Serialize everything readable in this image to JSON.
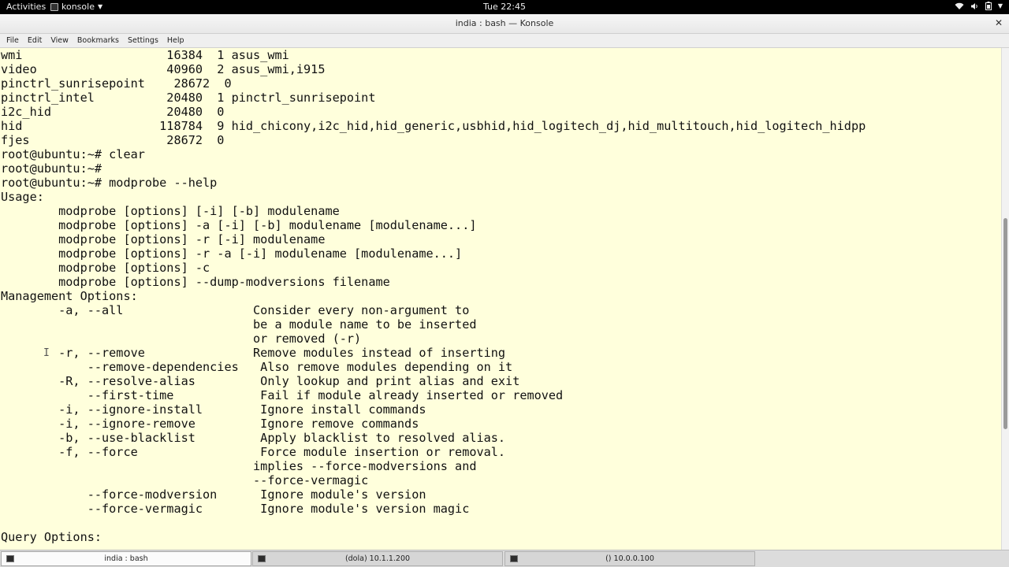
{
  "topbar": {
    "activities": "Activities",
    "app_name": "konsole",
    "clock": "Tue 22:45"
  },
  "window": {
    "title": "india : bash — Konsole",
    "close_glyph": "✕"
  },
  "menu": [
    "File",
    "Edit",
    "View",
    "Bookmarks",
    "Settings",
    "Help"
  ],
  "terminal": {
    "lines": [
      "wmi                    16384  1 asus_wmi",
      "video                  40960  2 asus_wmi,i915",
      "pinctrl_sunrisepoint    28672  0",
      "pinctrl_intel          20480  1 pinctrl_sunrisepoint",
      "i2c_hid                20480  0",
      "hid                   118784  9 hid_chicony,i2c_hid,hid_generic,usbhid,hid_logitech_dj,hid_multitouch,hid_logitech_hidpp",
      "fjes                   28672  0",
      "root@ubuntu:~# clear",
      "root@ubuntu:~#",
      "root@ubuntu:~# modprobe --help",
      "Usage:",
      "        modprobe [options] [-i] [-b] modulename",
      "        modprobe [options] -a [-i] [-b] modulename [modulename...]",
      "        modprobe [options] -r [-i] modulename",
      "        modprobe [options] -r -a [-i] modulename [modulename...]",
      "        modprobe [options] -c",
      "        modprobe [options] --dump-modversions filename",
      "Management Options:",
      "        -a, --all                  Consider every non-argument to",
      "                                   be a module name to be inserted",
      "                                   or removed (-r)",
      "        -r, --remove               Remove modules instead of inserting",
      "            --remove-dependencies   Also remove modules depending on it",
      "        -R, --resolve-alias         Only lookup and print alias and exit",
      "            --first-time            Fail if module already inserted or removed",
      "        -i, --ignore-install        Ignore install commands",
      "        -i, --ignore-remove         Ignore remove commands",
      "        -b, --use-blacklist         Apply blacklist to resolved alias.",
      "        -f, --force                 Force module insertion or removal.",
      "                                   implies --force-modversions and",
      "                                   --force-vermagic",
      "            --force-modversion      Ignore module's version",
      "            --force-vermagic        Ignore module's version magic",
      "",
      "Query Options:"
    ]
  },
  "tabs": [
    {
      "label": "india : bash",
      "active": true
    },
    {
      "label": "(dola) 10.1.1.200",
      "active": false
    },
    {
      "label": "() 10.0.0.100",
      "active": false
    }
  ]
}
